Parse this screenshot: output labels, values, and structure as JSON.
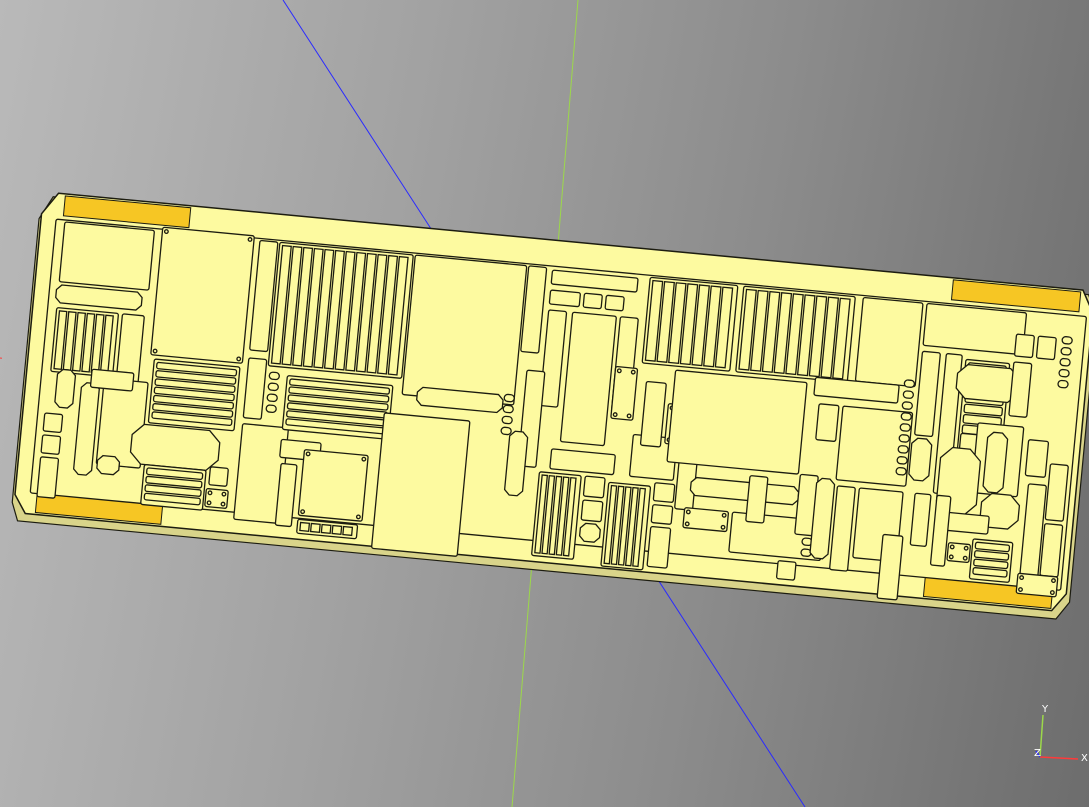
{
  "viewport": {
    "background_top": "#b9b9b9",
    "background_bottom": "#6d6d6d"
  },
  "axes": {
    "x_label": "X",
    "y_label": "Y",
    "z_label": "Z",
    "x_color": "#ff3a3a",
    "y_color": "#9cd84a",
    "z_color": "#2a2aff"
  },
  "model": {
    "name": "panel",
    "face_color": "#fdfaa0",
    "edge_color": "#1c1c10",
    "highlight_color": "#f6c624"
  }
}
